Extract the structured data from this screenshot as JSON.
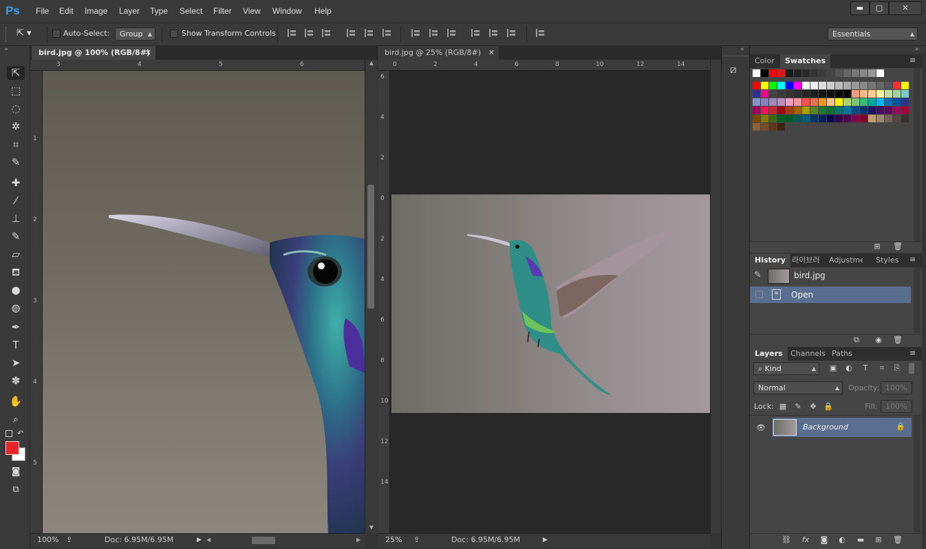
{
  "app": {
    "logo": "Ps"
  },
  "menu": [
    "File",
    "Edit",
    "Image",
    "Layer",
    "Type",
    "Select",
    "Filter",
    "View",
    "Window",
    "Help"
  ],
  "window_controls": {
    "minimize": "▬",
    "maximize": "▢",
    "close": "✕"
  },
  "options": {
    "auto_select_label": "Auto-Select:",
    "auto_select_value": "Group",
    "show_transform_label": "Show Transform Controls",
    "workspace": "Essentials"
  },
  "documents": [
    {
      "tab_title": "bird.jpg @ 100% (RGB/8#)",
      "zoom": "100%",
      "doc_size": "Doc: 6.95M/6.95M",
      "h_ruler": [
        "3",
        "4",
        "5",
        "6"
      ],
      "v_ruler": [
        "1",
        "2",
        "3",
        "4",
        "5"
      ]
    },
    {
      "tab_title": "bird.jpg @ 25% (RGB/8#)",
      "zoom": "25%",
      "doc_size": "Doc: 6.95M/6.95M",
      "h_ruler": [
        "0",
        "2",
        "4",
        "6",
        "8",
        "10",
        "12",
        "14"
      ],
      "v_ruler": [
        "6",
        "4",
        "2",
        "0",
        "2",
        "4",
        "6",
        "8",
        "10",
        "12",
        "14"
      ]
    }
  ],
  "colors": {
    "foreground": "#e8262a",
    "background": "#ffffff",
    "accent_selected": "#5a6f8f"
  },
  "swatches_panel": {
    "tabs": [
      "Color",
      "Swatches"
    ],
    "active": "Swatches"
  },
  "history_panel": {
    "tabs": [
      "History",
      "라이브러",
      "Adjustme",
      "Styles"
    ],
    "active": "History",
    "snapshot": "bird.jpg",
    "states": [
      "Open"
    ]
  },
  "layers_panel": {
    "tabs": [
      "Layers",
      "Channels",
      "Paths"
    ],
    "active": "Layers",
    "filter": "Kind",
    "blend_mode": "Normal",
    "opacity_label": "Opacity:",
    "opacity_value": "100%",
    "lock_label": "Lock:",
    "fill_label": "Fill:",
    "fill_value": "100%",
    "layers": [
      {
        "name": "Background",
        "visible": true,
        "locked": true
      }
    ]
  },
  "tools": [
    "move-icon",
    "marquee-icon",
    "lasso-icon",
    "magic-wand-icon",
    "crop-icon",
    "eyedropper-icon",
    "healing-brush-icon",
    "brush-icon",
    "clone-stamp-icon",
    "history-brush-icon",
    "eraser-icon",
    "paint-bucket-icon",
    "blur-icon",
    "dodge-icon",
    "pen-icon",
    "type-icon",
    "path-selection-icon",
    "shape-icon",
    "hand-icon",
    "zoom-icon"
  ]
}
